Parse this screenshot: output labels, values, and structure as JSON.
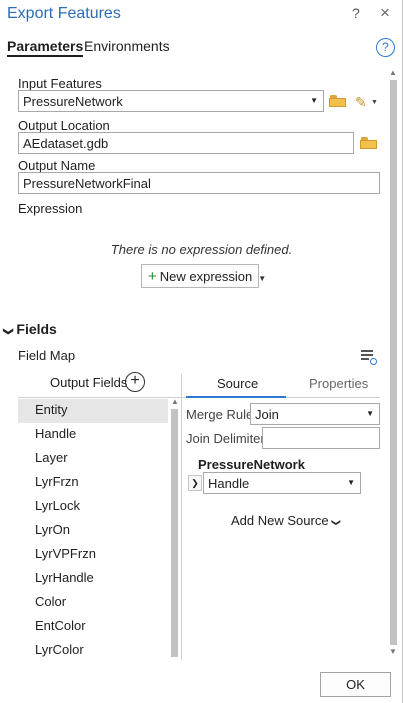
{
  "window": {
    "title": "Export Features",
    "help_glyph": "?",
    "close_glyph": "×"
  },
  "tabs": {
    "parameters": "Parameters",
    "environments": "Environments",
    "help_icon_glyph": "?"
  },
  "params": {
    "input_features_label": "Input Features",
    "input_features_value": "PressureNetwork",
    "output_location_label": "Output Location",
    "output_location_value": "AEdataset.gdb",
    "output_name_label": "Output Name",
    "output_name_value": "PressureNetworkFinal",
    "expression_label": "Expression",
    "no_expression_text": "There is no expression defined.",
    "new_expression_label": "New expression"
  },
  "fields": {
    "section_label": "Fields",
    "field_map_label": "Field Map",
    "output_fields_header": "Output Fields",
    "items": [
      "Entity",
      "Handle",
      "Layer",
      "LyrFrzn",
      "LyrLock",
      "LyrOn",
      "LyrVPFrzn",
      "LyrHandle",
      "Color",
      "EntColor",
      "LyrColor"
    ],
    "selected_item": "Entity"
  },
  "source_panel": {
    "tab_source": "Source",
    "tab_properties": "Properties",
    "merge_rule_label": "Merge Rule",
    "merge_rule_value": "Join",
    "join_delimiter_label": "Join Delimiter",
    "join_delimiter_value": "",
    "source_name": "PressureNetwork",
    "source_field_value": "Handle",
    "add_new_source_label": "Add New Source"
  },
  "footer": {
    "ok_label": "OK"
  },
  "colors": {
    "title_blue": "#2b6cb5",
    "accent_blue": "#2b7bd4",
    "plus_green": "#2d8a2d",
    "folder_yellow": "#f2c04d"
  },
  "icons": [
    "folder-icon",
    "pencil-icon",
    "add-field-icon",
    "field-map-icon",
    "help-icon"
  ]
}
